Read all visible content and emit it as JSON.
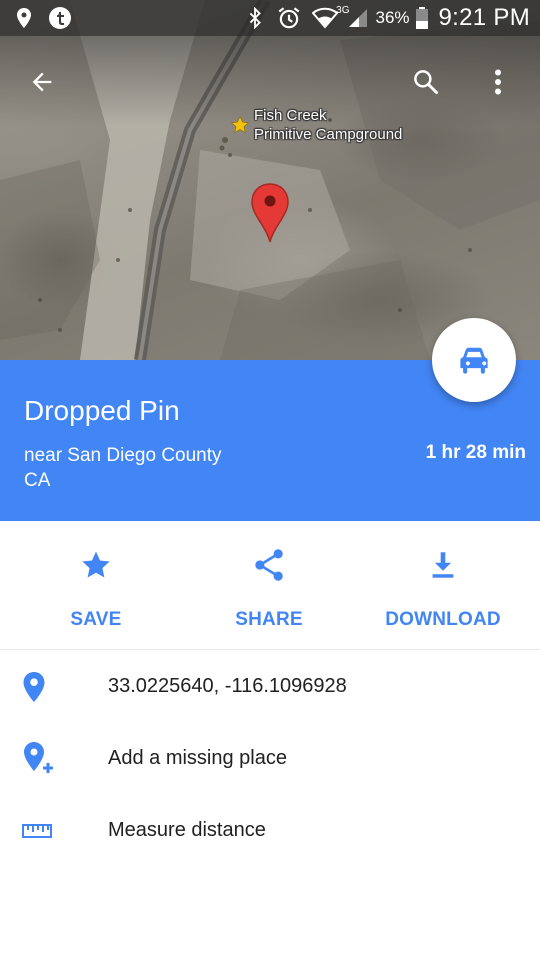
{
  "status_bar": {
    "icons_left": [
      "location-icon",
      "tumblr-icon"
    ],
    "network": "3G",
    "battery": "36%",
    "time": "9:21 PM"
  },
  "map": {
    "place_label_line1": "Fish Creek",
    "place_label_line2": "Primitive Campground",
    "buttons": [
      "back-arrow-icon",
      "search-icon",
      "more-vert-icon"
    ],
    "colors": {
      "pin": "#e53935",
      "star": "#f4c20d"
    }
  },
  "place": {
    "title": "Dropped Pin",
    "subtitle_line1": "near San Diego County",
    "subtitle_line2": "CA",
    "eta": "1 hr 28 min",
    "color": "#4285f4"
  },
  "actions": {
    "save": "SAVE",
    "share": "SHARE",
    "download": "DOWNLOAD"
  },
  "details": {
    "coordinates": "33.0225640, -116.1096928",
    "add_missing_place": "Add a missing place",
    "measure_distance": "Measure distance"
  }
}
